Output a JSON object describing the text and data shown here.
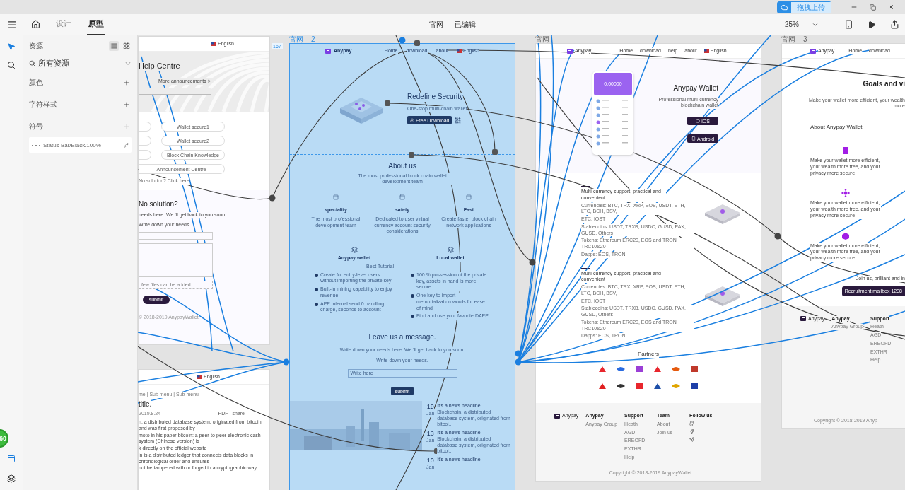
{
  "window": {
    "upload_button": "拖拽上传"
  },
  "toolbar": {
    "tabs": [
      {
        "label": "设计",
        "selected": false
      },
      {
        "label": "原型",
        "selected": true
      }
    ],
    "document_title": "官网 — 已编辑",
    "zoom": "25%"
  },
  "rail": {
    "tools": [
      {
        "kind": "pointer",
        "selected": true
      },
      {
        "kind": "search",
        "selected": false
      }
    ],
    "badge": "60"
  },
  "assets": {
    "title": "资源",
    "view_modes": [
      {
        "kind": "list",
        "selected": true
      },
      {
        "kind": "grid",
        "selected": false
      }
    ],
    "filter": "所有资源",
    "sections": [
      {
        "label": "颜色",
        "disabled": false
      },
      {
        "label": "字符样式",
        "disabled": false
      },
      {
        "label": "符号",
        "disabled": true
      }
    ],
    "symbols": [
      "Status Bar/Black/100%"
    ]
  },
  "canvas": {
    "dimension_badge": "167",
    "artboards": [
      {
        "kind": "help",
        "selected": false,
        "language": "English",
        "title": "Help Centre",
        "search_link": "More announcements >",
        "topics": [
          "Wallet secure1",
          "Wallet secure2",
          "Block Chain Knowledge"
        ],
        "wide_topic": "Announcement Centre",
        "hint": "No solution? Click here",
        "form_title": "No solution?",
        "form_intro": "needs here. We 'll get back to you soon.",
        "form_label": "Write down your needs.",
        "upload_hint": "few files can be added",
        "submit": "submit",
        "copyright": "© 2018-2019 AnypayWallet"
      },
      {
        "kind": "article",
        "selected": false,
        "language": "English",
        "breadcrumb": "me | Sub menu | Sub menu",
        "title": "title.",
        "date": "2019.8.24",
        "actions": [
          "PDF",
          "share"
        ],
        "paragraphs": [
          "n, a distributed database system, originated from bitcoin and was first proposed by",
          "moto in his paper bitcoin: a peer-to-peer electronic cash system (Chinese version) is",
          "k directly on the official website",
          "in is a distributed ledger that connects data blocks in chronological order and ensures",
          "not be tampered with or forged in a cryptographic way"
        ]
      },
      {
        "kind": "home",
        "selected": true,
        "label": "官网 – 2",
        "brand": "Anypay",
        "nav": [
          "Home",
          "download",
          "about"
        ],
        "language": "English",
        "hero_title": "Redefine Security",
        "hero_subtitle": "One-stop multi-chain wallet",
        "download_button": "Free Download",
        "about_title": "About us",
        "about_subtitle": "The most professional block chain wallet development team",
        "features": [
          {
            "title": "speciality",
            "text": "The most professional development team"
          },
          {
            "title": "safety",
            "text": "Dedicated to user virtual currency account security considerations"
          },
          {
            "title": "Fast",
            "text": "Create faster block chain network applications"
          }
        ],
        "products": [
          {
            "title": "Anypay wallet",
            "tag": "Best Tutorial",
            "points": [
              "Create for entry-level users without importing the private key",
              "Built-in mining capability to enjoy revenue",
              "APP internal send 0 handling charge, seconds to account"
            ]
          },
          {
            "title": "Local wallet",
            "points": [
              "100 % possession of the private key, assets in hand is more secure",
              "One key to import memorialization words for ease of mind",
              "Find and use your favorite DAPP"
            ]
          }
        ],
        "message_title": "Leave us a message.",
        "message_intro": "Write down your needs here. We 'll get back to you soon.",
        "message_label": "Write down your needs.",
        "message_placeholder": "Write here",
        "submit": "submit",
        "news": [
          {
            "day": "19",
            "month": "Jan",
            "headline": "It's a news headline.",
            "summary": "Blockchain, a distributed database system, originated from bitcoi..."
          },
          {
            "day": "13",
            "month": "Jan",
            "headline": "It's a news headline.",
            "summary": "Blockchain, a distributed database system, originated from bitcoi..."
          },
          {
            "day": "10",
            "month": "Jan",
            "headline": "It's a news headline."
          }
        ]
      },
      {
        "kind": "wallet",
        "selected": false,
        "label": "官网",
        "brand": "Anypay",
        "nav": [
          "Home",
          "download",
          "help",
          "about"
        ],
        "language": "English",
        "title": "Anypay Wallet",
        "subtitle": "Professional multi-currency blockchain wallet",
        "buttons": [
          "iOS",
          "Android"
        ],
        "balance": "0.00000",
        "sections": [
          {
            "title": "Multi-currency support, practical and convenient",
            "lines": [
              "Currencies: BTC, TRX, XRP, EOS, USDT, ETH, LTC, BCH, BSV,",
              "ETC, IOST",
              "Stablecoins: USDT, TRXB, USDC, GUSD, PAX, GUSD, Others",
              "Tokens: Ethereum ERC20, EOS and TRON TRC10&20",
              "Dapps: EOS, TRON"
            ]
          },
          {
            "title": "Multi-currency support, practical and convenient",
            "lines": [
              "Currencies: BTC, TRX, XRP, EOS, USDT, ETH, LTC, BCH, BSV,",
              "ETC, IOST",
              "Stablecoins: USDT, TRXB, USDC, GUSD, PAX, GUSD, Others",
              "Tokens: Ethereum ERC20, EOS and TRON TRC10&20",
              "Dapps: EOS, TRON"
            ]
          }
        ],
        "partners_title": "Partners",
        "partners": [
          {
            "color": "#e8262d"
          },
          {
            "color": "#2a6be0"
          },
          {
            "color": "#9b3fd6"
          },
          {
            "color": "#e8262d"
          },
          {
            "color": "#e55a0e"
          },
          {
            "color": "#c0392b"
          },
          {
            "color": "#e02020"
          },
          {
            "color": "#333333"
          },
          {
            "color": "#e8262d"
          },
          {
            "color": "#1d4fa8"
          },
          {
            "color": "#e0a500"
          },
          {
            "color": "#1d3fa8"
          }
        ],
        "footer": {
          "brand": "Anypay",
          "columns": [
            {
              "title": "Anypay",
              "links": [
                "Anypay Group"
              ]
            },
            {
              "title": "Support",
              "links": [
                "Heath",
                "AGD",
                "EREOFD",
                "EXTHR",
                "Help"
              ]
            },
            {
              "title": "Team",
              "links": [
                "About",
                "Join us"
              ]
            },
            {
              "title": "Follow us"
            }
          ],
          "copyright": "Copyright © 2018-2019 AnypayWallet"
        }
      },
      {
        "kind": "about",
        "selected": false,
        "label": "官网 – 3",
        "brand": "Anypay",
        "nav": [
          "Home",
          "download"
        ],
        "title": "Goals and vi",
        "intro": "Make your wallet more efficient, your wealth more",
        "section_title": "About Anypay Wallet",
        "items": [
          "Make your wallet more efficient, your wealth more free, and your privacy more secure",
          "Make your wallet more efficient, your wealth more free, and your privacy more secure",
          "Make your wallet more efficient, your wealth more free, and your privacy more secure"
        ],
        "join": "Join us, brilliant and in",
        "mail_button": "Recruitment mailbox 1238",
        "footer": {
          "brand": "Anypay",
          "columns": [
            {
              "title": "Anypay",
              "links": [
                "Anypay Group"
              ]
            },
            {
              "title": "Support",
              "links": [
                "Heath",
                "AGD",
                "EREOFD",
                "EXTHR",
                "Help"
              ]
            }
          ],
          "copyright": "Copyright © 2018-2019 Anyp"
        }
      }
    ]
  }
}
